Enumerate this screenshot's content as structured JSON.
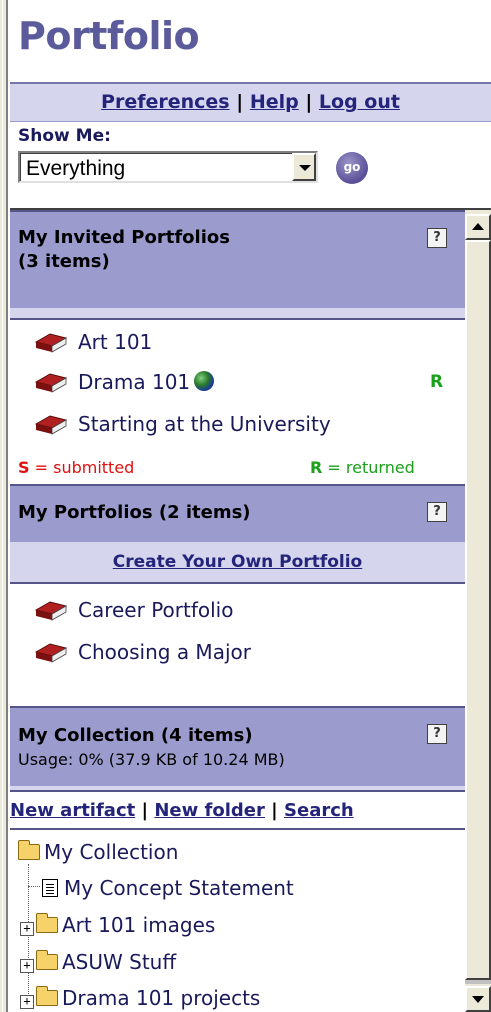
{
  "app": {
    "title": "Portfolio"
  },
  "topnav": {
    "preferences": "Preferences",
    "help": "Help",
    "logout": "Log out",
    "sep": "|"
  },
  "filter": {
    "label": "Show Me:",
    "selected": "Everything",
    "go_label": "go"
  },
  "invited": {
    "title": "My Invited Portfolios",
    "count": "(3 items)",
    "items": [
      {
        "label": "Art 101",
        "globe": false,
        "status": ""
      },
      {
        "label": "Drama 101",
        "globe": true,
        "status": "R"
      },
      {
        "label": "Starting at the University",
        "globe": false,
        "status": ""
      }
    ],
    "legend_s_key": "S",
    "legend_s_text": "= submitted",
    "legend_r_key": "R",
    "legend_r_text": "= returned"
  },
  "my_portfolios": {
    "title": "My Portfolios (2 items)",
    "create_link": "Create Your Own Portfolio",
    "items": [
      {
        "label": "Career Portfolio"
      },
      {
        "label": "Choosing a Major"
      }
    ]
  },
  "collection": {
    "title": "My Collection (4 items)",
    "usage": "Usage: 0% (37.9 KB of 10.24 MB)",
    "links": {
      "new_artifact": "New artifact",
      "new_folder": "New folder",
      "search": "Search",
      "sep": "|"
    },
    "tree": {
      "root": "My Collection",
      "children": [
        {
          "label": "My Concept Statement",
          "type": "document"
        },
        {
          "label": "Art 101 images",
          "type": "folder"
        },
        {
          "label": "ASUW Stuff",
          "type": "folder"
        },
        {
          "label": "Drama 101 projects",
          "type": "folder"
        }
      ]
    }
  },
  "help_icon": "?",
  "colors": {
    "header_band": "#9b9bce",
    "light_band": "#d5d5ee",
    "title": "#5b5b9c",
    "book": "#8b1a1a",
    "returned": "#1aa01a",
    "submitted": "#e01010"
  }
}
